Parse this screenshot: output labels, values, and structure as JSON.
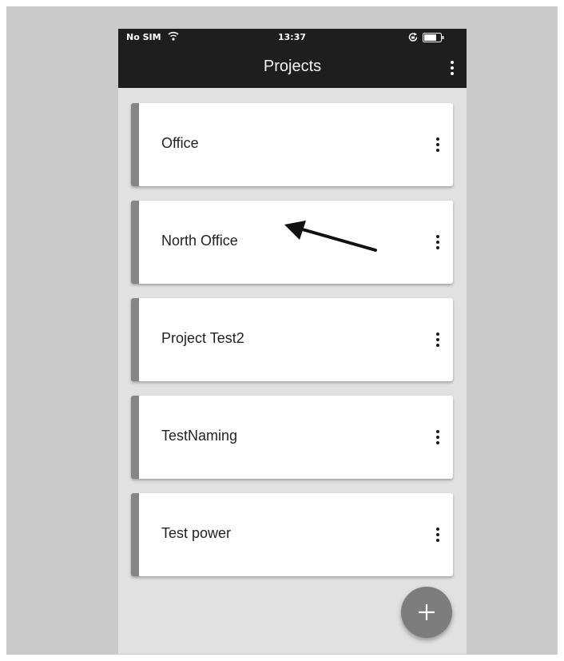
{
  "status_bar": {
    "carrier": "No SIM",
    "wifi_icon": "wifi-icon",
    "time": "13:37",
    "lock_icon": "orientation-lock-icon",
    "battery_icon": "battery-icon"
  },
  "app_bar": {
    "title": "Projects",
    "menu_icon": "more-vertical-icon"
  },
  "projects": [
    {
      "name": "Office"
    },
    {
      "name": "North Office"
    },
    {
      "name": "Project Test2"
    },
    {
      "name": "TestNaming"
    },
    {
      "name": "Test power"
    }
  ],
  "annotation": {
    "icon": "arrow-pointer-icon"
  },
  "fab": {
    "label": "+",
    "icon": "plus-icon"
  },
  "colors": {
    "app_bar": "#1e1e1e",
    "screen_background": "#e1e1e1",
    "card": "#ffffff",
    "card_accent": "#858585",
    "fab": "#7d7d7d",
    "frame": "#cacaca"
  }
}
